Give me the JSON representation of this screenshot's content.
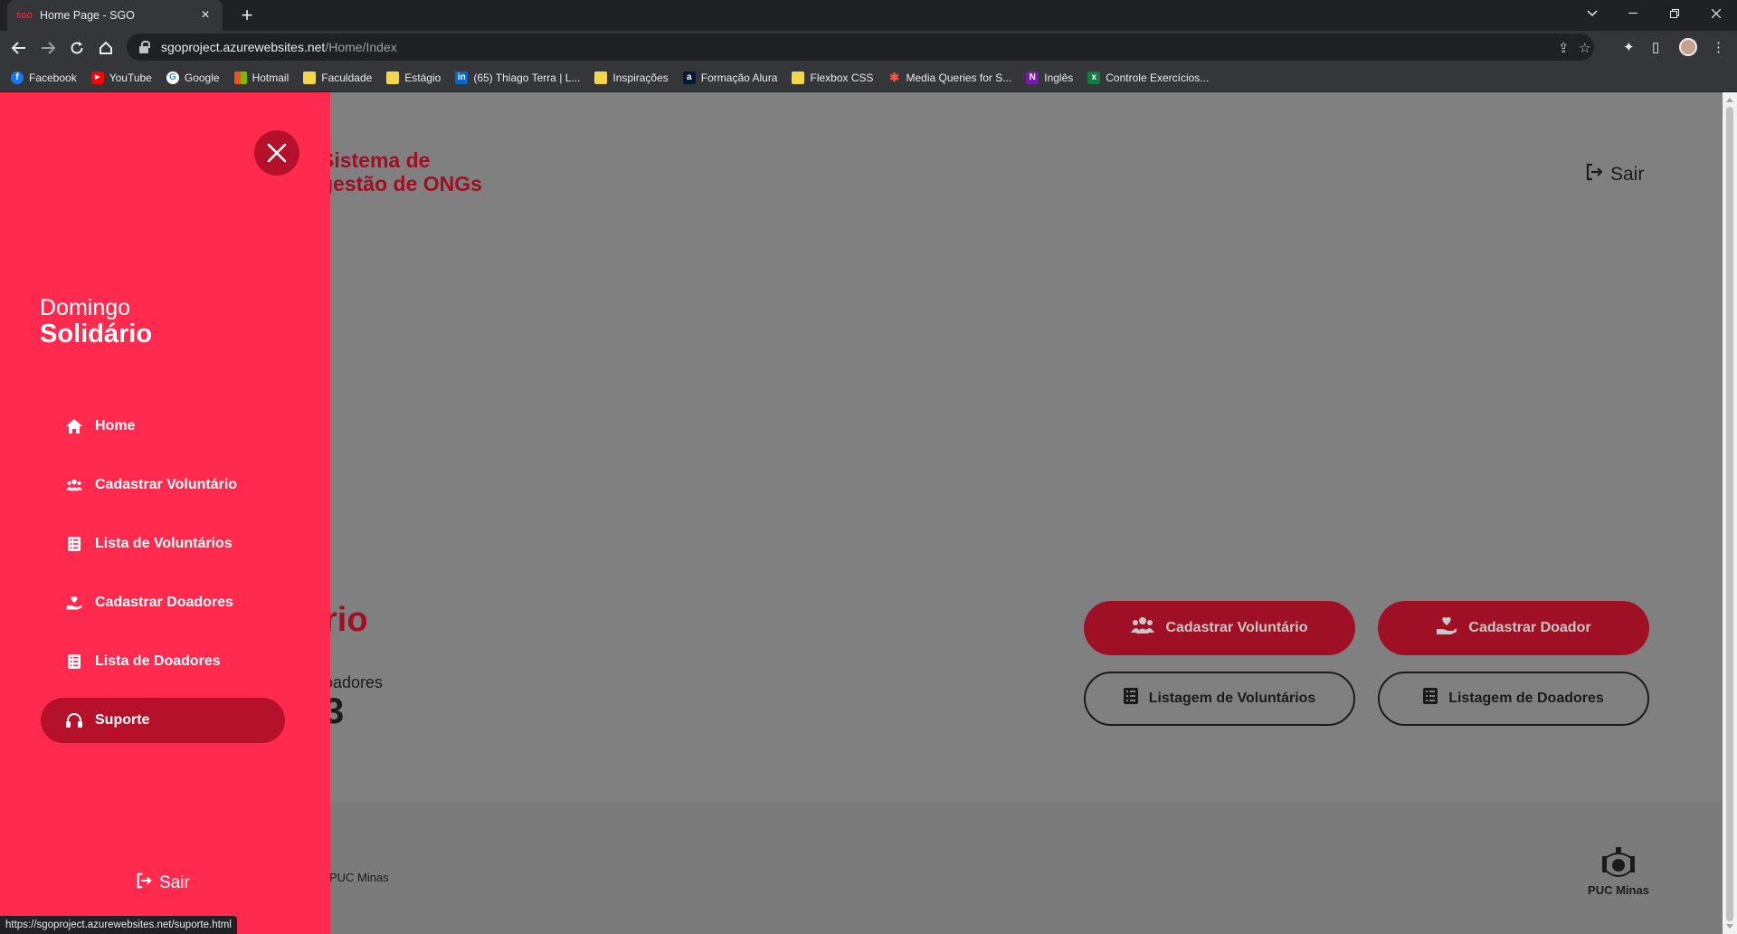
{
  "browser": {
    "tab_title": "Home Page - SGO",
    "tab_favicon": "SGO",
    "url_host": "sgoproject.azurewebsites.net",
    "url_path": "/Home/Index",
    "bookmarks": [
      {
        "label": "Facebook",
        "icon": "facebook-icon",
        "color": "#1877f2",
        "glyph": "f"
      },
      {
        "label": "YouTube",
        "icon": "youtube-icon",
        "color": "#ff0000",
        "glyph": "▶"
      },
      {
        "label": "Google",
        "icon": "google-icon",
        "color": "#ffffff",
        "glyph": "G"
      },
      {
        "label": "Hotmail",
        "icon": "microsoft-icon",
        "color": "#f25022",
        "glyph": ""
      },
      {
        "label": "Faculdade",
        "icon": "folder-icon",
        "color": "#f5d54a",
        "glyph": ""
      },
      {
        "label": "Estágio",
        "icon": "folder-icon",
        "color": "#f5d54a",
        "glyph": ""
      },
      {
        "label": "(65) Thiago Terra | L...",
        "icon": "linkedin-icon",
        "color": "#0a66c2",
        "glyph": "in"
      },
      {
        "label": "Inspirações",
        "icon": "folder-icon",
        "color": "#f5d54a",
        "glyph": ""
      },
      {
        "label": "Formação Alura",
        "icon": "alura-icon",
        "color": "#051933",
        "glyph": "a"
      },
      {
        "label": "Flexbox CSS",
        "icon": "folder-icon",
        "color": "#f5d54a",
        "glyph": ""
      },
      {
        "label": "Media Queries for S...",
        "icon": "asterisk-icon",
        "color": "#35363a",
        "glyph": "✱"
      },
      {
        "label": "Inglês",
        "icon": "onenote-icon",
        "color": "#7719aa",
        "glyph": "N"
      },
      {
        "label": "Controle Exercícios...",
        "icon": "excel-icon",
        "color": "#107c41",
        "glyph": "x"
      }
    ],
    "status_url": "https://sgoproject.azurewebsites.net/suporte.html"
  },
  "header": {
    "brand_line1": "Sistema de",
    "brand_line2": "gestão de ONGs",
    "logout_label": "Sair"
  },
  "hero": {
    "title_fragment": "rio",
    "stat_label": "oadores",
    "stat_value": "3"
  },
  "actions": [
    {
      "label": "Cadastrar Voluntário",
      "style": "filled",
      "icon": "users-icon"
    },
    {
      "label": "Cadastrar Doador",
      "style": "filled",
      "icon": "hand-heart-icon"
    },
    {
      "label": "Listagem de Voluntários",
      "style": "outline",
      "icon": "list-icon"
    },
    {
      "label": "Listagem de Doadores",
      "style": "outline",
      "icon": "list-icon"
    }
  ],
  "footer": {
    "left_text": "PUC Minas",
    "logo_label": "PUC Minas"
  },
  "sidebar": {
    "brand_line1": "Domingo",
    "brand_line2": "Solidário",
    "items": [
      {
        "label": "Home",
        "icon": "home-icon",
        "active": false
      },
      {
        "label": "Cadastrar Voluntário",
        "icon": "users-icon",
        "active": false
      },
      {
        "label": "Lista de Voluntários",
        "icon": "list-icon",
        "active": false
      },
      {
        "label": "Cadastrar Doadores",
        "icon": "hand-heart-icon",
        "active": false
      },
      {
        "label": "Lista de Doadores",
        "icon": "list-icon",
        "active": false
      },
      {
        "label": "Suporte",
        "icon": "headset-icon",
        "active": true
      }
    ],
    "logout_label": "Sair"
  },
  "colors": {
    "sidebar_bg": "#ff2a4d",
    "accent_dark": "#b5112a",
    "overlay": "#808080"
  }
}
